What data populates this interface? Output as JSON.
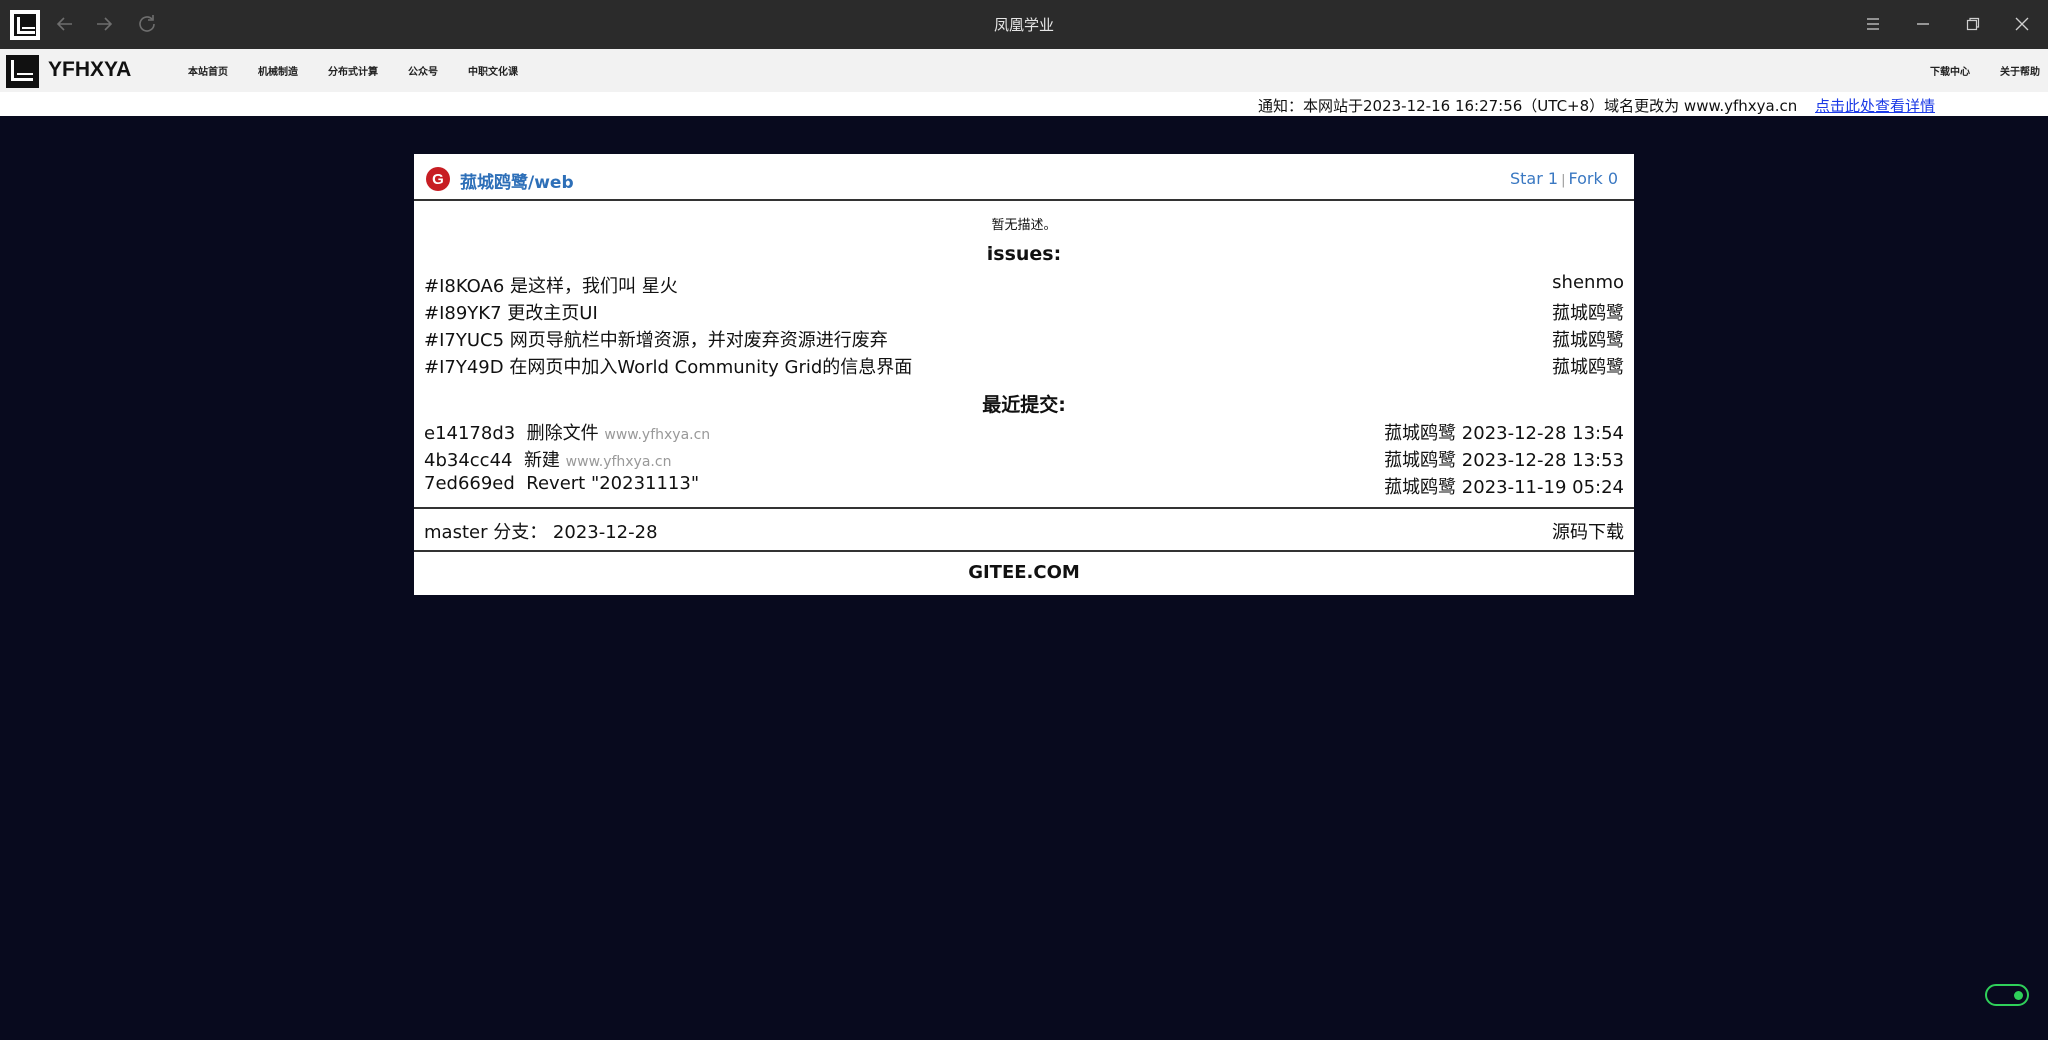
{
  "window": {
    "title": "凤凰学业"
  },
  "nav": {
    "brand": "YFHXYA",
    "items": [
      "本站首页",
      "机械制造",
      "分布式计算",
      "公众号",
      "中职文化课"
    ],
    "right_items": [
      "下载中心",
      "关于帮助"
    ]
  },
  "notice": {
    "text": "通知：本网站于2023-12-16 16:27:56（UTC+8）域名更改为 www.yfhxya.cn",
    "link": "点击此处查看详情"
  },
  "repo": {
    "name": "菰城鸥鹭/web",
    "stars": "Star 1",
    "forks": "Fork 0",
    "separator": "|",
    "description": "暂无描述。",
    "issues_title": "issues:",
    "issues": [
      {
        "title": "#I8KOA6 是这样，我们叫 星火",
        "author": "shenmo"
      },
      {
        "title": "#I89YK7 更改主页UI",
        "author": "菰城鸥鹭"
      },
      {
        "title": "#I7YUC5 网页导航栏中新增资源，并对废弃资源进行废弃",
        "author": "菰城鸥鹭"
      },
      {
        "title": "#I7Y49D 在网页中加入World Community Grid的信息界面",
        "author": "菰城鸥鹭"
      }
    ],
    "commits_title": "最近提交:",
    "commits": [
      {
        "hash": "e14178d3",
        "message": "删除文件",
        "host": "www.yfhxya.cn",
        "author_date": "菰城鸥鹭 2023-12-28 13:54"
      },
      {
        "hash": "4b34cc44",
        "message": "新建",
        "host": "www.yfhxya.cn",
        "author_date": "菰城鸥鹭 2023-12-28 13:53"
      },
      {
        "hash": "7ed669ed",
        "message": "Revert \"20231113\"",
        "host": "",
        "author_date": "菰城鸥鹭 2023-11-19 05:24"
      }
    ],
    "branch": "master 分支： 2023-12-28",
    "download": "源码下载",
    "footer": "GITEE.COM"
  },
  "icons": {
    "back": "arrow-left-icon",
    "forward": "arrow-right-icon",
    "reload": "reload-icon",
    "menu": "menu-icon",
    "minimize": "minimize-icon",
    "restore": "restore-icon",
    "close": "close-icon",
    "gitee": "gitee-icon",
    "gitee_glyph": "G"
  },
  "colors": {
    "titlebar": "#2b2b2b",
    "page_bg": "#080a1e",
    "link": "#1a39e6",
    "repo": "#2d6fb8",
    "gitee": "#c71d23",
    "toggle": "#2fd05a"
  }
}
